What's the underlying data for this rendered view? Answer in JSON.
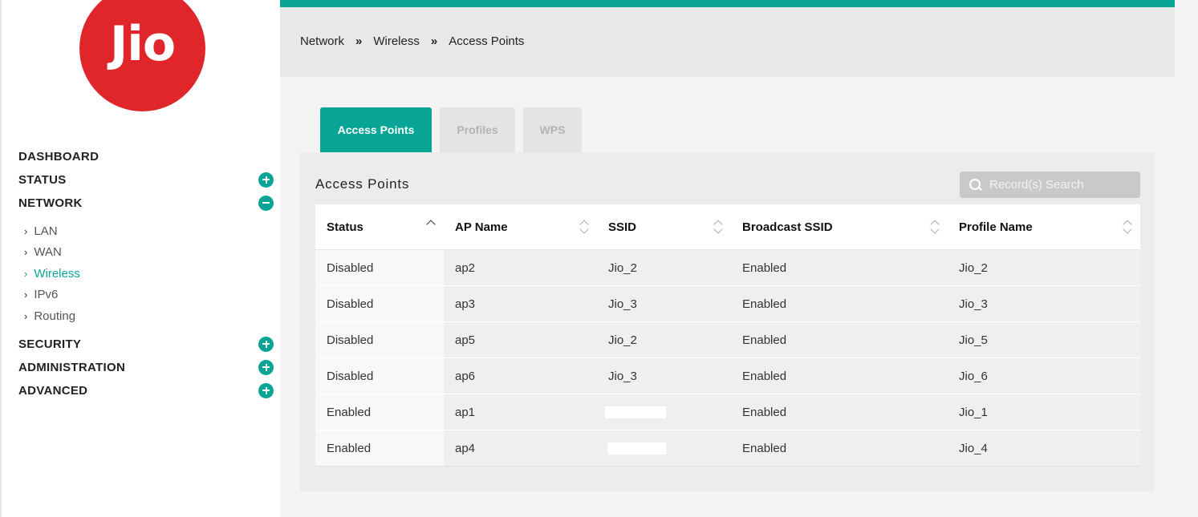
{
  "brand": {
    "logo_text": "Jio",
    "logo_color": "#e1262b",
    "accent_color": "#08a597"
  },
  "sidebar": {
    "items": [
      {
        "label": "DASHBOARD",
        "toggle": null
      },
      {
        "label": "STATUS",
        "toggle": "expand"
      },
      {
        "label": "NETWORK",
        "toggle": "collapse"
      },
      {
        "label": "SECURITY",
        "toggle": "expand"
      },
      {
        "label": "ADMINISTRATION",
        "toggle": "expand"
      },
      {
        "label": "ADVANCED",
        "toggle": "expand"
      }
    ],
    "network_sub": [
      {
        "label": "LAN",
        "active": false
      },
      {
        "label": "WAN",
        "active": false
      },
      {
        "label": "Wireless",
        "active": true
      },
      {
        "label": "IPv6",
        "active": false
      },
      {
        "label": "Routing",
        "active": false
      }
    ],
    "chevron": "›"
  },
  "breadcrumb": {
    "items": [
      "Network",
      "Wireless",
      "Access Points"
    ],
    "separator": "»"
  },
  "tabs": [
    {
      "label": "Access Points",
      "active": true
    },
    {
      "label": "Profiles",
      "active": false
    },
    {
      "label": "WPS",
      "active": false
    }
  ],
  "panel": {
    "title": "Access Points",
    "search_placeholder": "Record(s) Search"
  },
  "table": {
    "columns": [
      "Status",
      "AP Name",
      "SSID",
      "Broadcast SSID",
      "Profile Name"
    ],
    "sort": {
      "column": "Status",
      "direction": "ascending"
    },
    "rows": [
      {
        "status": "Disabled",
        "ap_name": "ap2",
        "ssid": "Jio_2",
        "broadcast_ssid": "Enabled",
        "profile_name": "Jio_2"
      },
      {
        "status": "Disabled",
        "ap_name": "ap3",
        "ssid": "Jio_3",
        "broadcast_ssid": "Enabled",
        "profile_name": "Jio_3"
      },
      {
        "status": "Disabled",
        "ap_name": "ap5",
        "ssid": "Jio_2",
        "broadcast_ssid": "Enabled",
        "profile_name": "Jio_5"
      },
      {
        "status": "Disabled",
        "ap_name": "ap6",
        "ssid": "Jio_3",
        "broadcast_ssid": "Enabled",
        "profile_name": "Jio_6"
      },
      {
        "status": "Enabled",
        "ap_name": "ap1",
        "ssid": "",
        "broadcast_ssid": "Enabled",
        "profile_name": "Jio_1"
      },
      {
        "status": "Enabled",
        "ap_name": "ap4",
        "ssid": "",
        "broadcast_ssid": "Enabled",
        "profile_name": "Jio_4"
      }
    ]
  }
}
